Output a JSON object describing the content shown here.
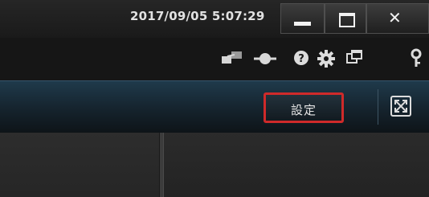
{
  "titlebar": {
    "datetime": "2017/09/05 5:07:29",
    "controls": [
      "minimize",
      "maximize",
      "close"
    ]
  },
  "iconbar": {
    "icons": [
      "network-status-icon",
      "connection-icon",
      "help-icon",
      "gear-icon",
      "window-layout-icon",
      "key-icon"
    ]
  },
  "toolbar": {
    "settings_label": "設定",
    "fullscreen_icon": "fullscreen-icon"
  },
  "colors": {
    "highlight": "#cf2a2a",
    "toolbar_top": "#1f3a4b"
  }
}
